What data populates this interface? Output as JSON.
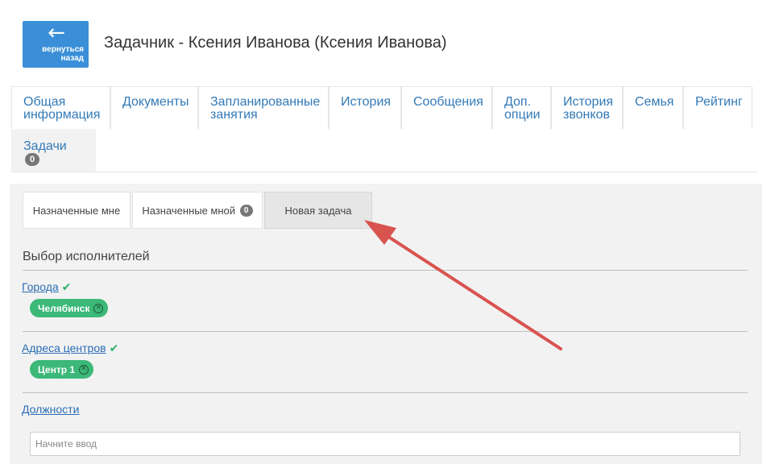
{
  "header": {
    "back_label_line1": "вернуться",
    "back_label_line2": "назад",
    "back_icon": "arrow-left-icon",
    "title": "Задачник - Ксения Иванова (Ксения Иванова)",
    "accent": "#3a8fd8"
  },
  "tabs": [
    {
      "line1": "Общая",
      "line2": "информация"
    },
    {
      "line1": "Документы",
      "line2": ""
    },
    {
      "line1": "Запланированные",
      "line2": "занятия"
    },
    {
      "line1": "История",
      "line2": ""
    },
    {
      "line1": "Сообщения",
      "line2": ""
    },
    {
      "line1": "Доп.",
      "line2": "опции"
    },
    {
      "line1": "История",
      "line2": "звонков"
    },
    {
      "line1": "Семья",
      "line2": ""
    },
    {
      "line1": "Рейтинг",
      "line2": ""
    },
    {
      "label": "Задачи",
      "badge": "0",
      "active": true
    }
  ],
  "subtabs": [
    {
      "label": "Назначенные мне"
    },
    {
      "label": "Назначенные мной",
      "badge": "0"
    },
    {
      "label": "Новая задача",
      "active": true
    }
  ],
  "form": {
    "section_title": "Выбор исполнителей",
    "cities": {
      "label": "Города",
      "check_icon": "checkmark-icon",
      "chip": "Челябинск",
      "chip_remove_icon": "remove-circle-icon"
    },
    "centers": {
      "label": "Адреса центров",
      "check_icon": "checkmark-icon",
      "chip": "Центр 1",
      "chip_remove_icon": "remove-circle-icon"
    },
    "positions": {
      "label": "Должности"
    },
    "input_placeholder": "Начните ввод"
  },
  "annotation": {
    "icon": "red-arrow-icon",
    "color": "#d9534f"
  }
}
